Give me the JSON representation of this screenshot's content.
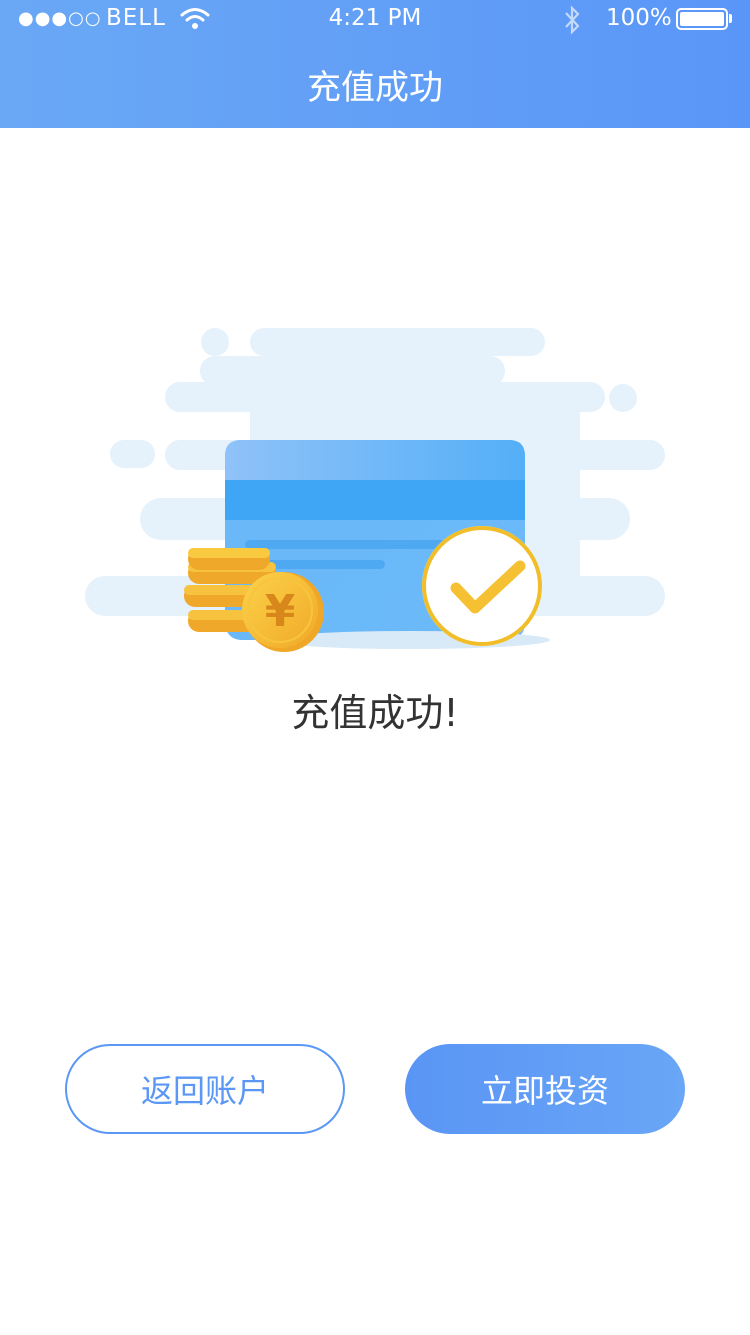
{
  "status_bar": {
    "signal": "●●●○○",
    "carrier": "BELL",
    "time": "4:21 PM",
    "battery": "100%"
  },
  "header": {
    "title": "充值成功"
  },
  "illustration": {
    "coin_symbol": "¥"
  },
  "result": {
    "message": "充值成功!"
  },
  "actions": {
    "back_label": "返回账户",
    "invest_label": "立即投资"
  },
  "colors": {
    "accent": "#5b97f4",
    "coin": "#f5b835",
    "card": "#4aa9f6",
    "cloud": "#e6f1fb"
  },
  "icons": [
    "wifi-icon",
    "bluetooth-icon",
    "battery-icon",
    "check-icon",
    "yuan-coin-icon"
  ]
}
